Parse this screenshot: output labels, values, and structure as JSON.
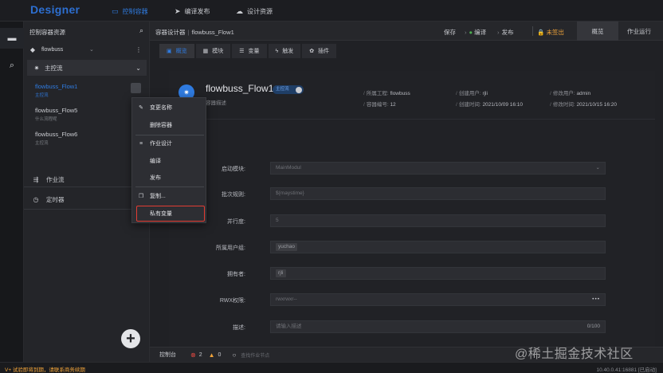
{
  "app": {
    "title": "Designer"
  },
  "nav": [
    {
      "icon": "monitor-icon",
      "label": "控制容器"
    },
    {
      "icon": "send-icon",
      "label": "编译发布"
    },
    {
      "icon": "cloud-icon",
      "label": "设计资源"
    }
  ],
  "sidebar": {
    "title": "控制容器资源",
    "project": "flowbuss",
    "section": "主控流",
    "flows": [
      {
        "name": "flowbuss_Flow1",
        "sub": "主控流"
      },
      {
        "name": "flowbuss_Flow5",
        "sub": "什么流程呢"
      },
      {
        "name": "flowbuss_Flow6",
        "sub": "主控流"
      }
    ],
    "links": [
      {
        "icon": "jobflow-icon",
        "label": "作业流"
      },
      {
        "icon": "clock-icon",
        "label": "定时器"
      }
    ]
  },
  "context_menu": {
    "items": [
      "变更名称",
      "删除容器",
      "作业设计",
      "编译",
      "发布",
      "复制...",
      "私有变量"
    ]
  },
  "toolbar": {
    "breadcrumb_root": "容器设计器",
    "breadcrumb_leaf": "flowbuss_Flow1",
    "save": "保存",
    "compile": "编译",
    "publish": "发布",
    "unsigned": "未签出",
    "tab_overview": "概览",
    "tab_runtime": "作业运行"
  },
  "subtabs": [
    "概览",
    "模块",
    "变量",
    "触发",
    "插件"
  ],
  "card": {
    "title": "flowbuss_Flow1",
    "badge": "主控流",
    "desc": "容器描述",
    "meta": {
      "project_k": "所属工程:",
      "project_v": "flowbuss",
      "code_k": "容器编号:",
      "code_v": "12",
      "creator_k": "创建用户:",
      "creator_v": "rjli",
      "ctime_k": "创建时间:",
      "ctime_v": "2021/10/09 16:10",
      "modifier_k": "修改用户:",
      "modifier_v": "admin",
      "mtime_k": "修改时间:",
      "mtime_v": "2021/10/15 16:20"
    }
  },
  "form": {
    "start_label": "启动模块:",
    "start_value": "MainModul",
    "batch_label": "批次规则:",
    "batch_value": "${maystime}",
    "parallel_label": "并行度:",
    "parallel_value": "5",
    "user_label": "所属用户组:",
    "user_value": "yuchao",
    "owner_label": "拥有者:",
    "owner_value": "rjli",
    "rwx_label": "RWX权限:",
    "rwx_value": "rwxrwxr--",
    "desc_label": "描述:",
    "desc_placeholder": "请输入描述",
    "desc_count": "0/100"
  },
  "console": {
    "label": "控制台",
    "errors": "2",
    "warnings": "0",
    "search_placeholder": "查找作业节点"
  },
  "status": {
    "warning": "V+ 试验即将到期，请联系商务续期",
    "right": "10.40.0.41:16881  [已启动]"
  },
  "watermark": "@稀土掘金技术社区",
  "colors": {
    "accent": "#2f7be0",
    "error": "#e84a43",
    "warning": "#f0a33a",
    "highlight": "#e23c33"
  }
}
